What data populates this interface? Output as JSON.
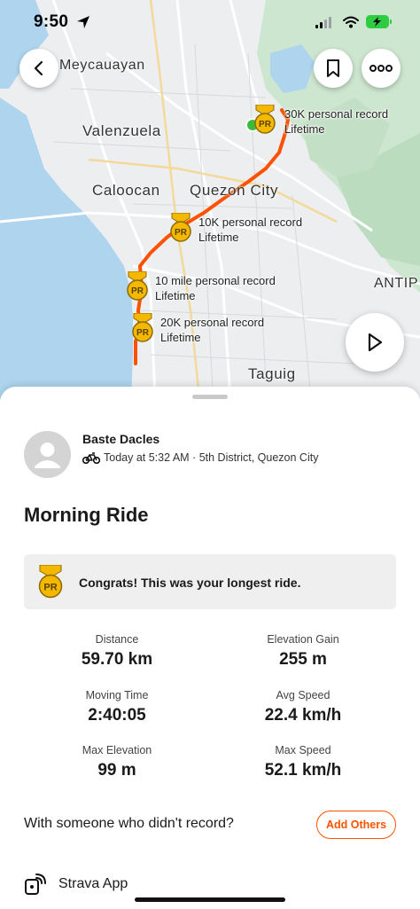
{
  "status_bar": {
    "time": "9:50"
  },
  "map": {
    "places": {
      "meycauayan": "Meycauayan",
      "valenzuela": "Valenzuela",
      "caloocan": "Caloocan",
      "quezon_city": "Quezon City",
      "antipolo": "ANTIP",
      "taguig": "Taguig"
    },
    "personal_records": [
      {
        "line1": "30K personal record",
        "line2": "Lifetime"
      },
      {
        "line1": "10K personal record",
        "line2": "Lifetime"
      },
      {
        "line1": "10 mile personal record",
        "line2": "Lifetime"
      },
      {
        "line1": "20K personal record",
        "line2": "Lifetime"
      }
    ],
    "badge_text": "PR",
    "route_color": "#fc5200"
  },
  "activity": {
    "athlete_name": "Baste Dacles",
    "meta": "Today at 5:32 AM · 5th District, Quezon City",
    "title": "Morning Ride",
    "congrats": "Congrats! This was your longest ride.",
    "stats": {
      "distance": {
        "label": "Distance",
        "value": "59.70 km"
      },
      "elevation_gain": {
        "label": "Elevation Gain",
        "value": "255 m"
      },
      "moving_time": {
        "label": "Moving Time",
        "value": "2:40:05"
      },
      "avg_speed": {
        "label": "Avg Speed",
        "value": "22.4 km/h"
      },
      "max_elevation": {
        "label": "Max Elevation",
        "value": "99 m"
      },
      "max_speed": {
        "label": "Max Speed",
        "value": "52.1 km/h"
      }
    },
    "with_someone": "With someone who didn't record?",
    "add_others_label": "Add Others",
    "device_label": "Strava App"
  },
  "icons": {
    "back": "chevron-left-icon",
    "bookmark": "bookmark-icon",
    "more": "more-dots-icon",
    "play": "play-icon",
    "bike": "bike-icon",
    "device": "watch-icon",
    "avatar": "person-icon",
    "badge": "pr-medal-icon"
  },
  "colors": {
    "accent": "#fc5200",
    "badge_gold": "#f5b800"
  }
}
